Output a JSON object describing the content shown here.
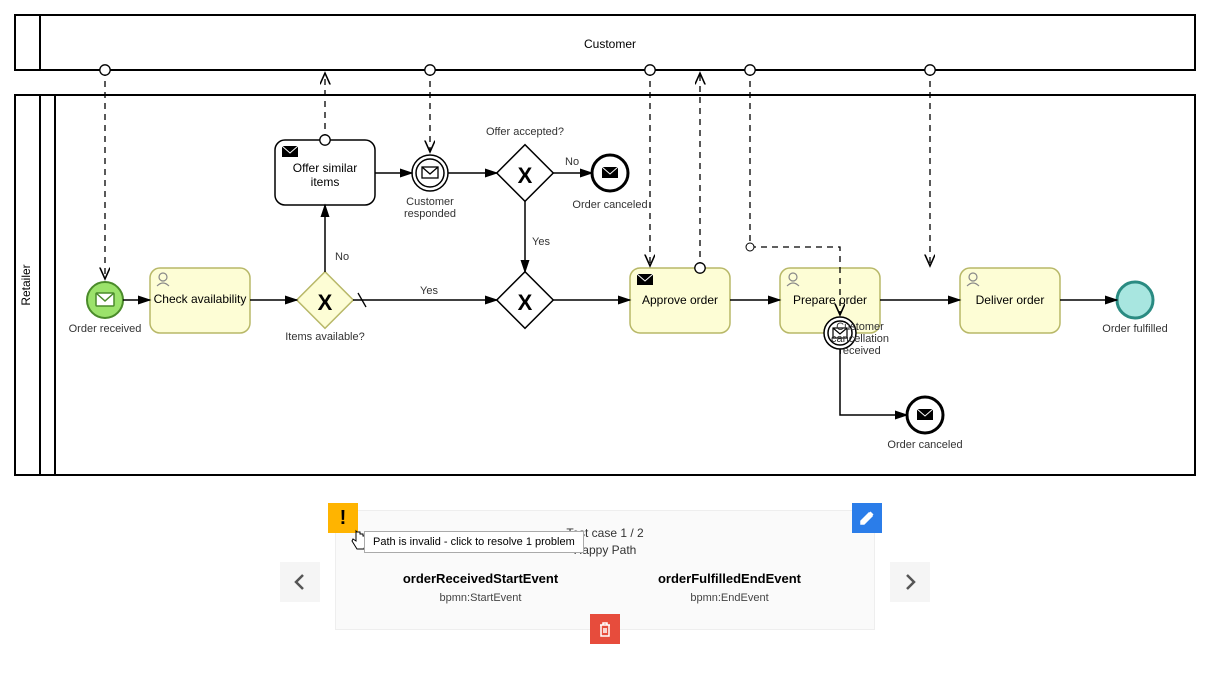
{
  "customerLane": "Customer",
  "retailerLane": "Retailer",
  "start": {
    "label": "Order received"
  },
  "task_check": "Check availability",
  "gw_items": {
    "label": "Items available?",
    "yes": "Yes",
    "no": "No"
  },
  "task_offer": "Offer similar items",
  "ev_responded": "Customer responded",
  "gw_offer": {
    "label": "Offer accepted?",
    "yes": "Yes",
    "no": "No"
  },
  "end_cancel1": "Order canceled",
  "task_approve": "Approve order",
  "task_prepare": "Prepare order",
  "ev_cancel_rx": "Customer cancellation received",
  "end_cancel2": "Order canceled",
  "task_deliver": "Deliver order",
  "end_fulfilled": "Order fulfilled",
  "panel": {
    "warning_tooltip": "Path is invalid - click to resolve 1 problem",
    "counter": "Test case 1 / 2",
    "title": "Happy Path",
    "left_name": "orderReceivedStartEvent",
    "left_type": "bpmn:StartEvent",
    "right_name": "orderFulfilledEndEvent",
    "right_type": "bpmn:EndEvent"
  }
}
